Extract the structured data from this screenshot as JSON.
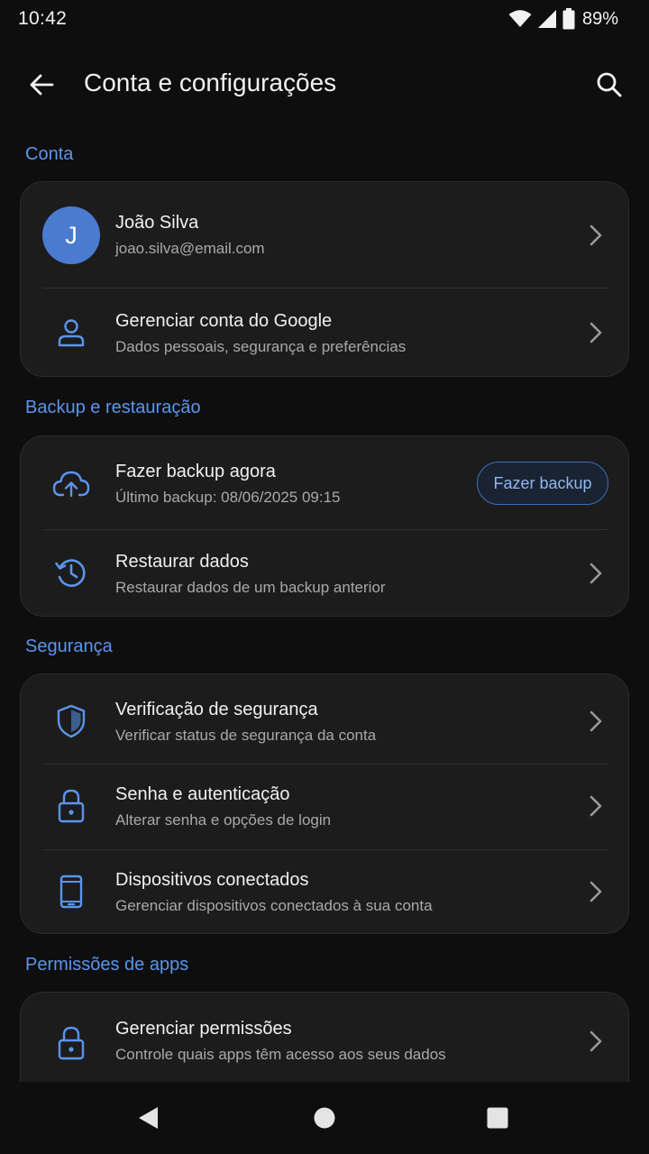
{
  "status": {
    "time": "10:42",
    "battery": "89%"
  },
  "header": {
    "title": "Conta e configurações"
  },
  "sections": {
    "account": {
      "title": "Conta",
      "profile": {
        "initial": "J",
        "name": "João Silva",
        "email": "joao.silva@email.com"
      },
      "manage": {
        "title": "Gerenciar conta do Google",
        "subtitle": "Dados pessoais, segurança e preferências"
      }
    },
    "backup": {
      "title": "Backup e restauração",
      "backup_now": {
        "title": "Fazer backup agora",
        "subtitle": "Último backup: 08/06/2025 09:15",
        "button": "Fazer backup"
      },
      "restore": {
        "title": "Restaurar dados",
        "subtitle": "Restaurar dados de um backup anterior"
      }
    },
    "security": {
      "title": "Segurança",
      "items": [
        {
          "title": "Verificação de segurança",
          "subtitle": "Verificar status de segurança da conta",
          "icon": "shield-icon"
        },
        {
          "title": "Senha e autenticação",
          "subtitle": "Alterar senha e opções de login",
          "icon": "lock-icon"
        },
        {
          "title": "Dispositivos conectados",
          "subtitle": "Gerenciar dispositivos conectados à sua conta",
          "icon": "phone-icon"
        }
      ]
    },
    "permissions": {
      "title": "Permissões de apps",
      "items": [
        {
          "title": "Gerenciar permissões",
          "subtitle": "Controle quais apps têm acesso aos seus dados",
          "icon": "lock-icon"
        }
      ]
    }
  },
  "colors": {
    "accent": "#5b95ec",
    "background": "#0e0e0e",
    "card": "#1c1c1d",
    "avatar": "#4a7bd0"
  }
}
